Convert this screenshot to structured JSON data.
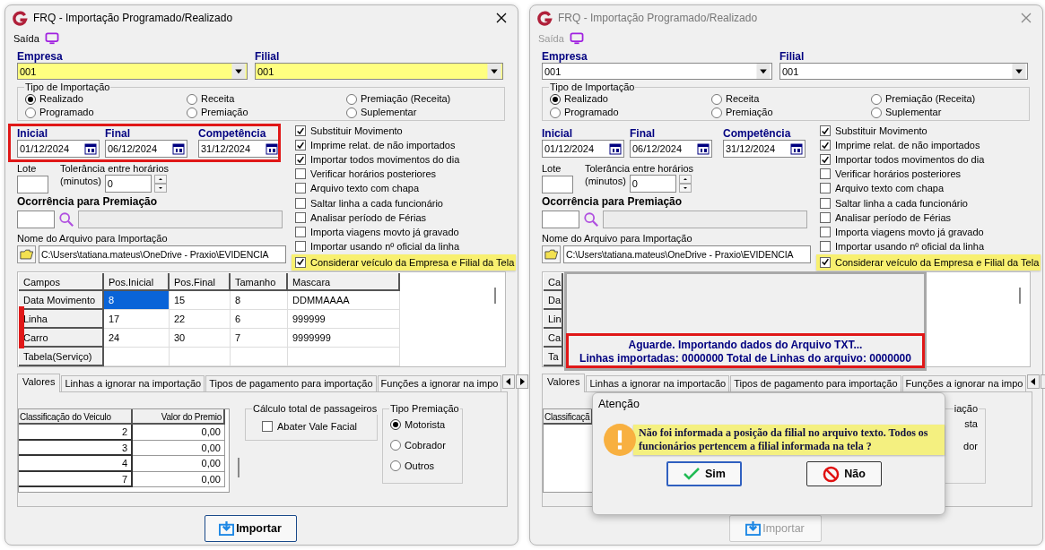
{
  "windows": [
    {
      "title": "FRQ - Importação Programado/Realizado",
      "active": true,
      "menu": {
        "label": "Saída",
        "disabled": false
      },
      "empresa": {
        "label": "Empresa",
        "value": "001",
        "highlighted": true
      },
      "filial": {
        "label": "Filial",
        "value": "001",
        "highlighted": true
      },
      "tipo_importacao": {
        "label": "Tipo de Importação",
        "options": [
          {
            "label": "Realizado",
            "selected": true
          },
          {
            "label": "Programado",
            "selected": false
          },
          {
            "label": "Receita",
            "selected": false
          },
          {
            "label": "Premiação",
            "selected": false
          },
          {
            "label": "Premiação (Receita)",
            "selected": false
          },
          {
            "label": "Suplementar",
            "selected": false
          }
        ]
      },
      "dates": {
        "highlight": true,
        "fields": [
          {
            "label": "Inicial",
            "value": "01/12/2024"
          },
          {
            "label": "Final",
            "value": "06/12/2024"
          },
          {
            "label": "Competência",
            "value": "31/12/2024"
          }
        ]
      },
      "checkboxes": [
        {
          "label": "Substituir Movimento",
          "checked": true,
          "highlighted": false
        },
        {
          "label": "Imprime relat. de não importados",
          "checked": true,
          "highlighted": false
        },
        {
          "label": "Importar todos movimentos do dia",
          "checked": true,
          "highlighted": false
        },
        {
          "label": "Verificar horários posteriores",
          "checked": false,
          "highlighted": false
        },
        {
          "label": "Arquivo texto com chapa",
          "checked": false,
          "highlighted": false
        },
        {
          "label": "Saltar linha a cada funcionário",
          "checked": false,
          "highlighted": false
        },
        {
          "label": "Analisar período de Férias",
          "checked": false,
          "highlighted": false
        },
        {
          "label": "Importa viagens movto já gravado",
          "checked": false,
          "highlighted": false
        },
        {
          "label": "Importar usando nº oficial da linha",
          "checked": false,
          "highlighted": false
        },
        {
          "label": "Considerar veículo da Empresa e Filial da Tela",
          "checked": true,
          "highlighted": true
        }
      ],
      "lote": {
        "label": "Lote"
      },
      "tolerancia": {
        "label": "Tolerância entre horários",
        "unit": "(minutos)",
        "value": "0"
      },
      "ocorrencia": {
        "label": "Ocorrência para Premiação"
      },
      "arquivo": {
        "label": "Nome do Arquivo para Importação",
        "value": "C:\\Users\\tatiana.mateus\\OneDrive - Praxio\\EVIDENCIA"
      },
      "table": {
        "columns": [
          "Campos",
          "Pos.Inicial",
          "Pos.Final",
          "Tamanho",
          "Mascara"
        ],
        "rows": [
          {
            "highlight": false,
            "cells": [
              {
                "text": "Data Movimento",
                "selected": false
              },
              {
                "text": "8",
                "selected": true
              },
              {
                "text": "15",
                "selected": false
              },
              {
                "text": "8",
                "selected": false
              },
              {
                "text": "DDMMAAAA",
                "selected": false
              }
            ]
          },
          {
            "highlight": true,
            "cells": [
              {
                "text": "Linha",
                "selected": false
              },
              {
                "text": "17",
                "selected": false
              },
              {
                "text": "22",
                "selected": false
              },
              {
                "text": "6",
                "selected": false
              },
              {
                "text": "999999",
                "selected": false
              }
            ]
          },
          {
            "highlight": true,
            "cells": [
              {
                "text": "Carro",
                "selected": false
              },
              {
                "text": "24",
                "selected": false
              },
              {
                "text": "30",
                "selected": false
              },
              {
                "text": "7",
                "selected": false
              },
              {
                "text": "9999999",
                "selected": false
              }
            ]
          },
          {
            "highlight": false,
            "cells": [
              {
                "text": "Tabela(Serviço)",
                "selected": false
              }
            ]
          }
        ]
      },
      "tabs": [
        {
          "label": "Valores",
          "selected": true
        },
        {
          "label": "Linhas a ignorar na importação",
          "selected": false
        },
        {
          "label": "Tipos de pagamento para importação",
          "selected": false
        },
        {
          "label": "Funções a ignorar na impo",
          "selected": false
        }
      ],
      "premios": {
        "columns": [
          "Classificação do Veiculo",
          "Valor do Premio"
        ],
        "rows": [
          [
            "2",
            "0,00"
          ],
          [
            "3",
            "0,00"
          ],
          [
            "4",
            "0,00"
          ],
          [
            "7",
            "0,00"
          ]
        ]
      },
      "calculo": {
        "label": "Cálculo total de passageiros",
        "checkbox": {
          "label": "Abater Vale Facial",
          "checked": false
        }
      },
      "tipo_premiacao": {
        "label": "Tipo Premiação",
        "options": [
          {
            "label": "Motorista",
            "selected": true
          },
          {
            "label": "Cobrador",
            "selected": false
          },
          {
            "label": "Outros",
            "selected": false
          }
        ]
      },
      "importar": {
        "label": "Importar",
        "disabled": false
      }
    },
    {
      "title": "FRQ - Importação Programado/Realizado",
      "active": false,
      "menu": {
        "label": "Saída",
        "disabled": true
      },
      "empresa": {
        "label": "Empresa",
        "value": "001",
        "highlighted": false
      },
      "filial": {
        "label": "Filial",
        "value": "001",
        "highlighted": false
      },
      "tipo_importacao": {
        "label": "Tipo de Importação",
        "options": [
          {
            "label": "Realizado",
            "selected": true
          },
          {
            "label": "Programado",
            "selected": false
          },
          {
            "label": "Receita",
            "selected": false
          },
          {
            "label": "Premiação",
            "selected": false
          },
          {
            "label": "Premiação (Receita)",
            "selected": false
          },
          {
            "label": "Suplementar",
            "selected": false
          }
        ]
      },
      "dates": {
        "fields": [
          {
            "label": "Inicial",
            "value": "01/12/2024"
          },
          {
            "label": "Final",
            "value": "06/12/2024"
          },
          {
            "label": "Competência",
            "value": "31/12/2024"
          }
        ]
      },
      "checkboxes": [
        {
          "label": "Substituir Movimento",
          "checked": true,
          "highlighted": false
        },
        {
          "label": "Imprime relat. de não importados",
          "checked": true,
          "highlighted": false
        },
        {
          "label": "Importar todos movimentos do dia",
          "checked": true,
          "highlighted": false
        },
        {
          "label": "Verificar horários posteriores",
          "checked": false,
          "highlighted": false
        },
        {
          "label": "Arquivo texto com chapa",
          "checked": false,
          "highlighted": false
        },
        {
          "label": "Saltar linha a cada funcionário",
          "checked": false,
          "highlighted": false
        },
        {
          "label": "Analisar período de Férias",
          "checked": false,
          "highlighted": false
        },
        {
          "label": "Importa viagens movto já gravado",
          "checked": false,
          "highlighted": false
        },
        {
          "label": "Importar usando nº oficial da linha",
          "checked": false,
          "highlighted": false
        },
        {
          "label": "Considerar veículo da Empresa e Filial da Tela",
          "checked": true,
          "highlighted": true
        }
      ],
      "lote": {
        "label": "Lote"
      },
      "tolerancia": {
        "label": "Tolerância entre horários",
        "unit": "(minutos)",
        "value": "0"
      },
      "ocorrencia": {
        "label": "Ocorrência para Premiação"
      },
      "arquivo": {
        "label": "Nome do Arquivo para Importação",
        "value": "C:\\Users\\tatiana.mateus\\OneDrive - Praxio\\EVIDENCIA"
      },
      "table": {
        "columns": [
          "Ca"
        ],
        "rows": [
          {
            "cells": [
              {
                "text": "Da",
                "selected": false
              }
            ]
          },
          {
            "cells": [
              {
                "text": "Lin",
                "selected": false
              }
            ]
          },
          {
            "cells": [
              {
                "text": "Ca",
                "selected": false
              }
            ]
          },
          {
            "cells": [
              {
                "text": "Ta",
                "selected": false
              }
            ]
          }
        ]
      },
      "progress": {
        "highlight": true,
        "lines": [
          "Aguarde. Importando dados do Arquivo TXT...",
          "Linhas importadas: 0000000 Total de Linhas do arquivo: 0000000"
        ]
      },
      "tabs": [
        {
          "label": "Valores",
          "selected": true
        },
        {
          "label": "Linhas a ignorar na importacão",
          "selected": false
        },
        {
          "label": "Tipos de pagamento para importação",
          "selected": false
        },
        {
          "label": "Funções a ignorar na impo",
          "selected": false
        }
      ],
      "premios": {
        "columns": [
          "Classificaçã"
        ]
      },
      "tipo_premiacao": {
        "label": "iação",
        "options": [
          {
            "label": "sta"
          },
          {
            "label": "dor"
          }
        ]
      },
      "importar": {
        "label": "Importar",
        "disabled": true
      },
      "dialog": {
        "title": "Atenção",
        "message": "Não foi informada a posição da filial no arquivo texto. Todos os funcionários pertencem a filial informada na tela ?",
        "buttons": [
          {
            "label": "Sim",
            "kind": "yes",
            "focused": true
          },
          {
            "label": "Não",
            "kind": "no",
            "focused": false
          }
        ]
      }
    }
  ]
}
